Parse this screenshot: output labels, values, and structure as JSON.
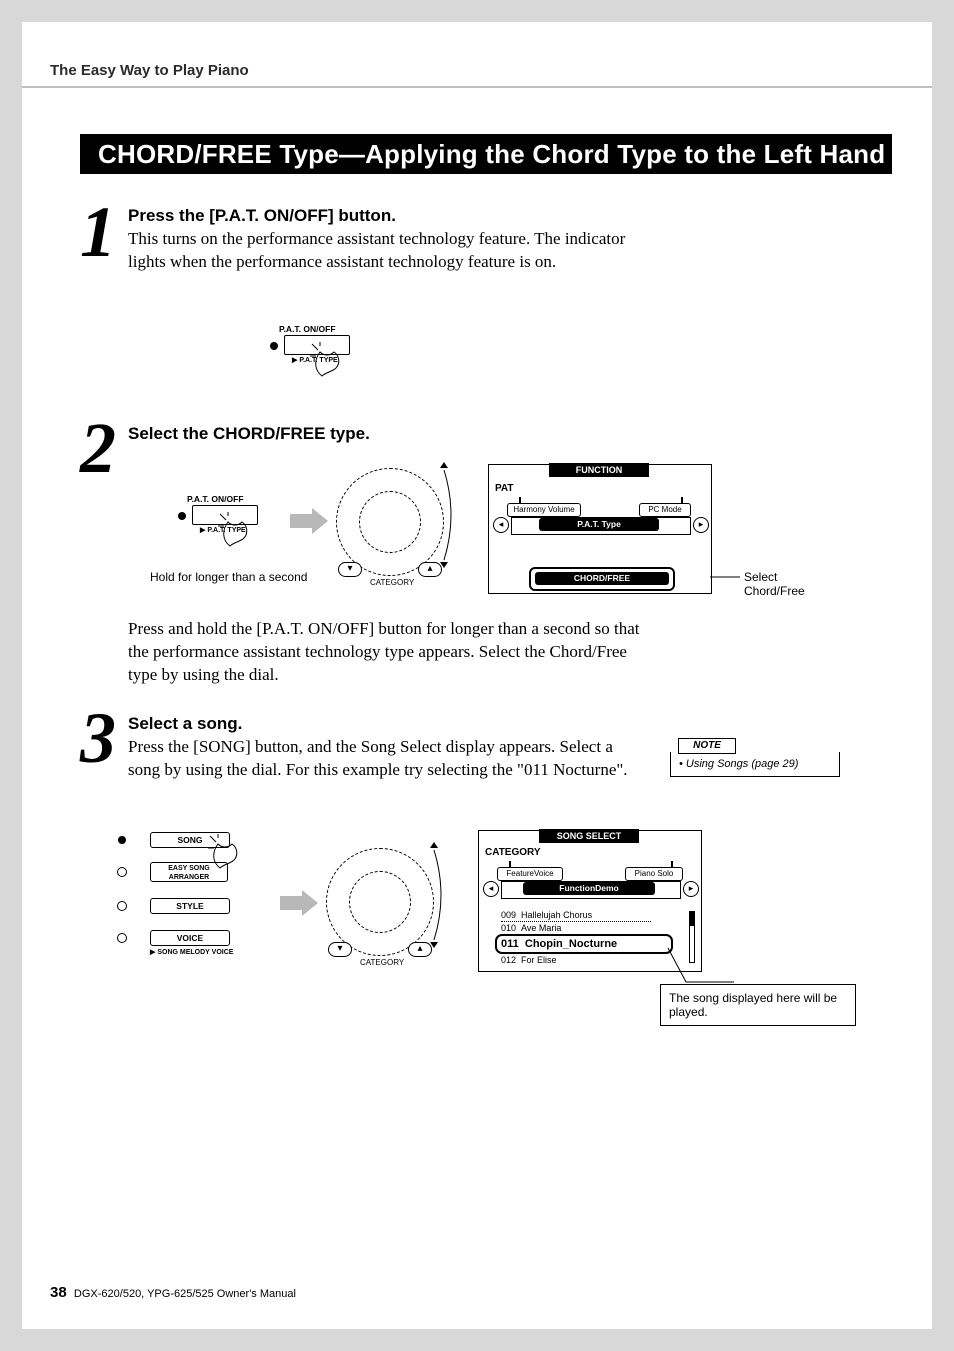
{
  "header": {
    "running": "The Easy Way to Play Piano"
  },
  "title": "CHORD/FREE Type—Applying the Chord Type to the Left Hand Only",
  "steps": {
    "s1": {
      "num": "1",
      "head": "Press the [P.A.T. ON/OFF] button.",
      "body": "This turns on the performance assistant technology feature.\nThe indicator lights when the performance assistant technology feature is on.",
      "fig": {
        "pat_label": "P.A.T. ON/OFF",
        "pat_type": "P.A.T. TYPE"
      }
    },
    "s2": {
      "num": "2",
      "head": "Select the CHORD/FREE type.",
      "fig": {
        "pat_label": "P.A.T. ON/OFF",
        "pat_type": "P.A.T. TYPE",
        "hold_caption": "Hold for longer than a second",
        "dial_category": "CATEGORY",
        "lcd_function": "FUNCTION",
        "lcd_pat": "PAT",
        "lcd_harmony": "Harmony Volume",
        "lcd_pcmode": "PC Mode",
        "lcd_pattype": "P.A.T. Type",
        "lcd_value": "CHORD/FREE",
        "callout": "Select Chord/Free"
      },
      "body": "Press and hold the [P.A.T. ON/OFF] button for longer than a second so that the performance assistant technology type appears. Select the Chord/Free type by using the dial."
    },
    "s3": {
      "num": "3",
      "head": "Select a song.",
      "body": "Press the [SONG] button, and the Song Select display appears. Select a song by using the dial. For this example try selecting the \"011 Nocturne\".",
      "note": {
        "label": "NOTE",
        "bullet": "• Using Songs (page 29)"
      },
      "fig": {
        "buttons": {
          "song": "SONG",
          "easy": "EASY SONG\nARRANGER",
          "style": "STYLE",
          "voice": "VOICE"
        },
        "melody_label": "SONG MELODY VOICE",
        "dial_category": "CATEGORY",
        "lcd_title": "SONG SELECT",
        "lcd_category": "CATEGORY",
        "lcd_left": "FeatureVoice",
        "lcd_right": "Piano Solo",
        "lcd_strip": "FunctionDemo",
        "songs": [
          {
            "no": "009",
            "name": "Hallelujah Chorus"
          },
          {
            "no": "010",
            "name": "Ave Maria"
          },
          {
            "no": "011",
            "name": "Chopin_Nocturne"
          },
          {
            "no": "012",
            "name": "For Elise"
          }
        ]
      },
      "callout": "The song displayed here will be played."
    }
  },
  "footer": {
    "page": "38",
    "manual": "DGX-620/520, YPG-625/525  Owner's Manual"
  }
}
